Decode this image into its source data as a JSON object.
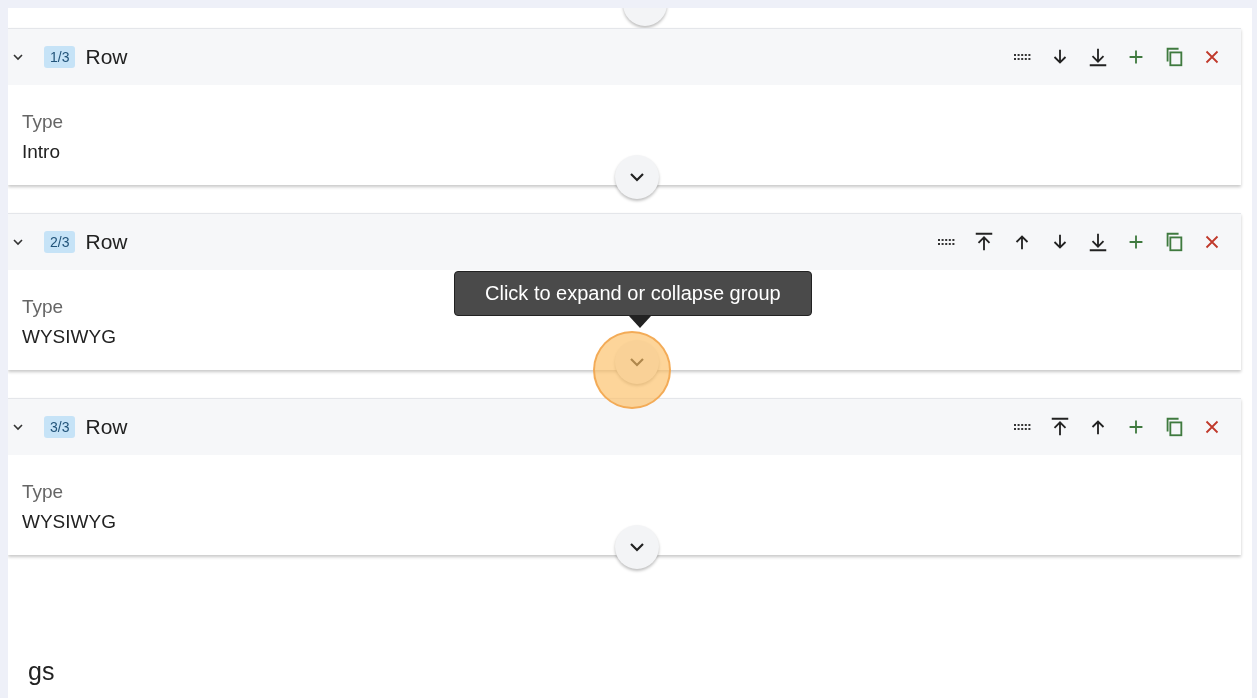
{
  "groups": [
    {
      "index": "1/3",
      "title": "Row",
      "expanded": true,
      "field_label": "Type",
      "field_value": "Intro",
      "actions": [
        {
          "kind": "drag"
        },
        {
          "kind": "down"
        },
        {
          "kind": "bottom"
        },
        {
          "kind": "add"
        },
        {
          "kind": "duplicate"
        },
        {
          "kind": "remove"
        }
      ],
      "toggle": {
        "highlighted": false
      }
    },
    {
      "index": "2/3",
      "title": "Row",
      "expanded": true,
      "field_label": "Type",
      "field_value": "WYSIWYG",
      "actions": [
        {
          "kind": "drag"
        },
        {
          "kind": "top"
        },
        {
          "kind": "up"
        },
        {
          "kind": "down"
        },
        {
          "kind": "bottom"
        },
        {
          "kind": "add"
        },
        {
          "kind": "duplicate"
        },
        {
          "kind": "remove"
        }
      ],
      "toggle": {
        "highlighted": true,
        "tooltip": "Click to expand or collapse group"
      }
    },
    {
      "index": "3/3",
      "title": "Row",
      "expanded": true,
      "field_label": "Type",
      "field_value": "WYSIWYG",
      "actions": [
        {
          "kind": "drag"
        },
        {
          "kind": "top"
        },
        {
          "kind": "up"
        },
        {
          "kind": "add"
        },
        {
          "kind": "duplicate"
        },
        {
          "kind": "remove"
        }
      ],
      "toggle": {
        "highlighted": false
      }
    }
  ],
  "section_heading": "gs"
}
